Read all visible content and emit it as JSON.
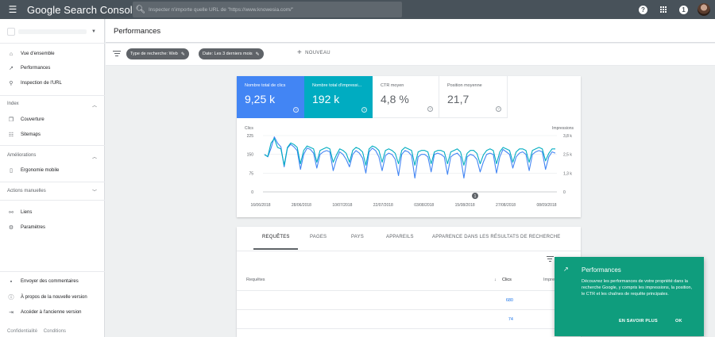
{
  "app": {
    "brand": "Google Search Console"
  },
  "search": {
    "placeholder": "Inspecter n'importe quelle URL de \"https://www.knowesia.com/\""
  },
  "topbar": {
    "help_icon": "help-icon",
    "notification_count": "1"
  },
  "sidebar": {
    "items_top": [
      {
        "label": "Vue d'ensemble",
        "icon": "home-icon"
      },
      {
        "label": "Performances",
        "icon": "trending-icon"
      },
      {
        "label": "Inspection de l'URL",
        "icon": "search-icon"
      }
    ],
    "sections": [
      {
        "title": "Index",
        "items": [
          {
            "label": "Couverture",
            "icon": "copy-icon"
          },
          {
            "label": "Sitemaps",
            "icon": "sitemap-icon"
          }
        ]
      },
      {
        "title": "Améliorations",
        "items": [
          {
            "label": "Ergonomie mobile",
            "icon": "mobile-icon"
          }
        ]
      },
      {
        "title": "Actions manuelles",
        "items": []
      }
    ],
    "items_bottom": [
      {
        "label": "Liens",
        "icon": "links-icon"
      },
      {
        "label": "Paramètres",
        "icon": "gear-icon"
      }
    ],
    "footer_items": [
      {
        "label": "Envoyer des commentaires",
        "icon": "feedback-icon"
      },
      {
        "label": "À propos de la nouvelle version",
        "icon": "info-icon"
      },
      {
        "label": "Accéder à l'ancienne version",
        "icon": "exit-icon"
      }
    ],
    "footer_links": [
      "Confidentialité",
      "Conditions"
    ]
  },
  "header": {
    "title": "Performances"
  },
  "filters": {
    "chips": [
      "Type de recherche: Web",
      "Date: Les 3 derniers mois"
    ],
    "new_label": "NOUVEAU"
  },
  "metrics": {
    "clicks": {
      "label": "Nombre total de clics",
      "value": "9,25 k"
    },
    "impressions": {
      "label": "Nombre total d'impressi...",
      "value": "192 k"
    },
    "ctr": {
      "label": "CTR moyen",
      "value": "4,8 %"
    },
    "position": {
      "label": "Position moyenne",
      "value": "21,7"
    }
  },
  "colors": {
    "clicks": "#4285f4",
    "impressions": "#00acc1",
    "topbar": "#48525a",
    "popup": "#0f9d7d"
  },
  "chart_data": {
    "type": "line",
    "ylabel_left": "Clics",
    "ylabel_right": "Impressions",
    "y_ticks_left": [
      "225",
      "150",
      "75",
      "0"
    ],
    "y_ticks_right": [
      "3,8 k",
      "2,5 k",
      "1,3 k",
      "0"
    ],
    "x_ticks": [
      "16/06/2018",
      "28/06/2018",
      "10/07/2018",
      "22/07/2018",
      "03/08/2018",
      "15/08/2018",
      "27/08/2018",
      "08/09/2018"
    ],
    "annotation": "1",
    "series": [
      {
        "name": "Clics",
        "axis": "left",
        "values": [
          150,
          140,
          175,
          220,
          195,
          180,
          100,
          175,
          190,
          180,
          165,
          90,
          150,
          175,
          170,
          155,
          95,
          150,
          160,
          165,
          160,
          85,
          130,
          160,
          150,
          130,
          100,
          150,
          165,
          155,
          135,
          75,
          160,
          175,
          165,
          140,
          85,
          145,
          155,
          150,
          130,
          65,
          150,
          165,
          160,
          145,
          55,
          140,
          150,
          150,
          140,
          80,
          150,
          155,
          150,
          140,
          70,
          140,
          150,
          155,
          140,
          55,
          140,
          150,
          145,
          130,
          80,
          120,
          150,
          155,
          150,
          75,
          140,
          170,
          160,
          150,
          95,
          140,
          155,
          160,
          150,
          85,
          150,
          160,
          165,
          160,
          90,
          140,
          160,
          155
        ]
      },
      {
        "name": "Impressions",
        "axis": "right",
        "values": [
          2500,
          2400,
          3300,
          3600,
          3000,
          2900,
          1800,
          3000,
          3300,
          3200,
          3000,
          1900,
          2800,
          3100,
          3000,
          2900,
          2000,
          2800,
          2900,
          3000,
          2900,
          2000,
          2500,
          2900,
          2800,
          2600,
          2000,
          2800,
          3000,
          2900,
          2700,
          1800,
          2900,
          3100,
          3000,
          2800,
          2000,
          2800,
          2900,
          2800,
          2600,
          1900,
          2800,
          3000,
          2900,
          2800,
          1800,
          2700,
          2800,
          2800,
          2700,
          1900,
          2700,
          2800,
          2800,
          2700,
          1900,
          2700,
          2800,
          2900,
          2700,
          1800,
          2600,
          2800,
          2800,
          2600,
          1900,
          2500,
          2800,
          2900,
          2800,
          1900,
          2700,
          3000,
          2900,
          2800,
          2000,
          2700,
          2900,
          2900,
          2800,
          2000,
          2800,
          2900,
          3000,
          2900,
          2100,
          2600,
          2900,
          2900
        ]
      }
    ]
  },
  "table": {
    "tabs": [
      "REQUÊTES",
      "PAGES",
      "PAYS",
      "APPAREILS",
      "APPARENCE DANS LES RÉSULTATS DE RECHERCHE"
    ],
    "columns": [
      "Requêtes",
      "Clics",
      "Impres"
    ],
    "rows": [
      {
        "clicks": "680"
      },
      {
        "clicks": "74"
      }
    ]
  },
  "popup": {
    "title": "Performances",
    "body": "Découvrez les performances de votre propriété dans la recherche Google, y compris les impressions, la position, le CTR et les chaînes de requête principales.",
    "learn_more": "EN SAVOIR PLUS",
    "ok": "OK"
  }
}
